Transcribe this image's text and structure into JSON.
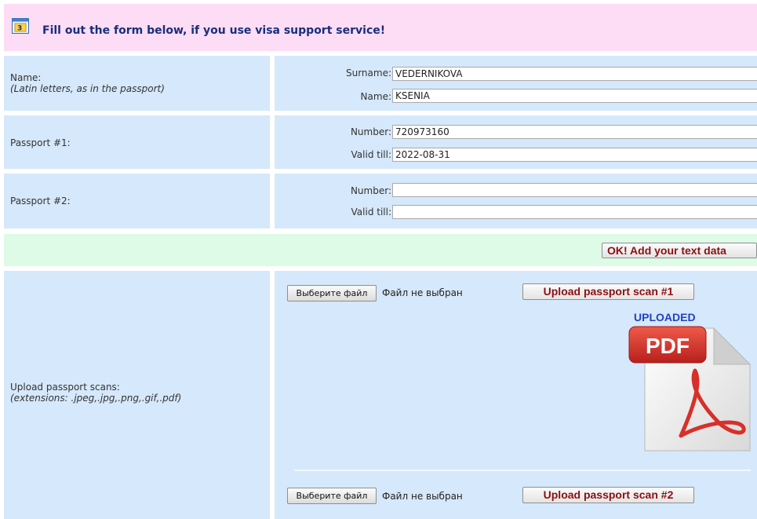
{
  "header": {
    "title": "Fill out the form below, if you use visa support service!",
    "icon": "form-icon"
  },
  "name_row": {
    "label": "Name:",
    "hint": "(Latin letters, as in the passport)",
    "surname_label": "Surname:",
    "surname_value": "VEDERNIKOVA",
    "name_label": "Name:",
    "name_value": "KSENIA"
  },
  "passport1": {
    "label": "Passport #1:",
    "number_label": "Number:",
    "number_value": "720973160",
    "valid_label": "Valid till:",
    "valid_value": "2022-08-31"
  },
  "passport2": {
    "label": "Passport #2:",
    "number_label": "Number:",
    "number_value": "",
    "valid_label": "Valid till:",
    "valid_value": ""
  },
  "ok_button": "OK! Add your text data",
  "upload": {
    "label": "Upload passport scans:",
    "hint": "(extensions: .jpeg,.jpg,.png,.gif,.pdf)",
    "choose_file": "Выберите файл",
    "no_file": "Файл не выбран",
    "scan1_button": "Upload passport scan #1",
    "scan2_button": "Upload passport scan #2",
    "uploaded_label": "UPLOADED",
    "pdf_badge": "PDF"
  },
  "colors": {
    "header_bg": "#fddcf6",
    "cell_bg": "#d6e8fb",
    "green_bg": "#ddfbe6",
    "button_text": "#8b0f12",
    "uploaded_text": "#1f43c4"
  }
}
